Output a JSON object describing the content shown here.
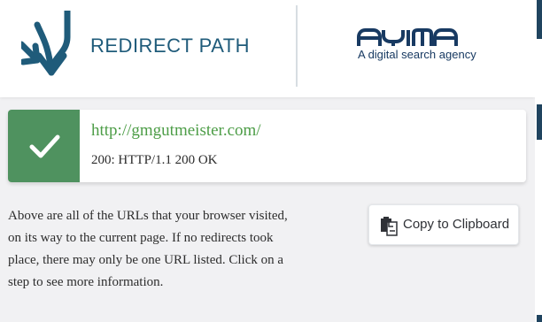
{
  "header": {
    "brand_left": {
      "title": "REDIRECT PATH",
      "logo_icon": "redirect-arrows-icon",
      "color": "#1f5b7a"
    },
    "brand_right": {
      "wordmark": "AYIMA",
      "tagline": "A digital search agency",
      "color": "#183a62"
    }
  },
  "results": [
    {
      "url": "http://gmgutmeister.com/",
      "status": "200: HTTP/1.1 200 OK",
      "status_icon": "checkmark-icon",
      "status_color": "#4f925f",
      "url_color": "#4d9d47"
    }
  ],
  "info": {
    "lines": [
      "Above are all of the URLs that your browser visited,",
      "on its way to the current page. If no redirects took",
      "place, there may only be one URL listed. Click on a",
      "step to see more information."
    ]
  },
  "actions": {
    "copy_button": {
      "label": "Copy to Clipboard",
      "icon": "clipboard-icon"
    }
  },
  "colors": {
    "panel_background": "#f1f1f3",
    "card_background": "#ffffff"
  }
}
